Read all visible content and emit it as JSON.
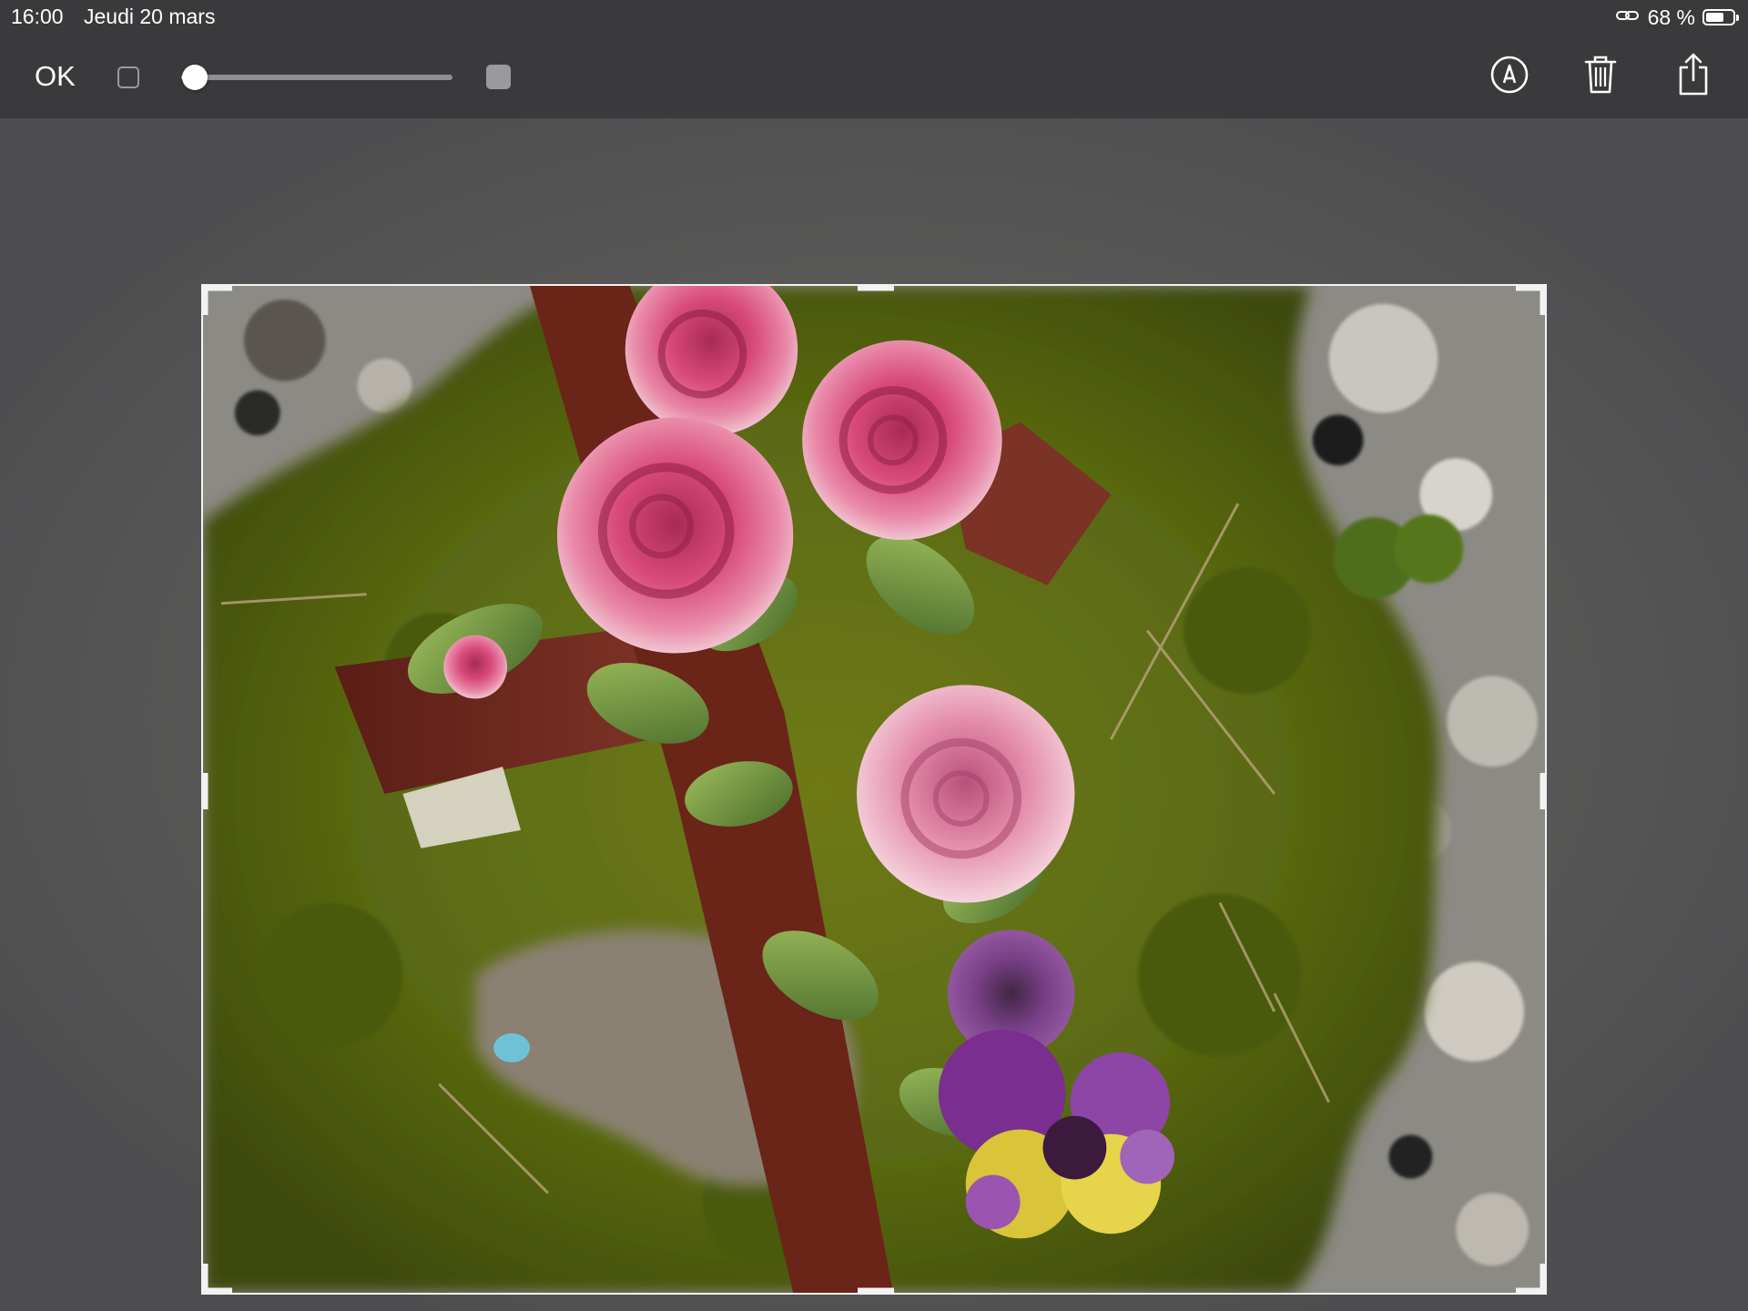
{
  "status_bar": {
    "time": "16:00",
    "date": "Jeudi 20 mars",
    "battery_percent": "68 %",
    "battery_level": 0.68,
    "icons": [
      "link-icon",
      "battery-icon"
    ]
  },
  "toolbar": {
    "done_label": "OK",
    "size_slider": {
      "min_icon": "small-square-icon",
      "max_icon": "large-square-icon",
      "value": 0.05
    },
    "actions": [
      "markup-icon",
      "trash-icon",
      "share-icon"
    ]
  },
  "photo": {
    "subject": "ceramic roses and pansies on moss-covered stone",
    "selection": "crop-frame-with-handles"
  }
}
